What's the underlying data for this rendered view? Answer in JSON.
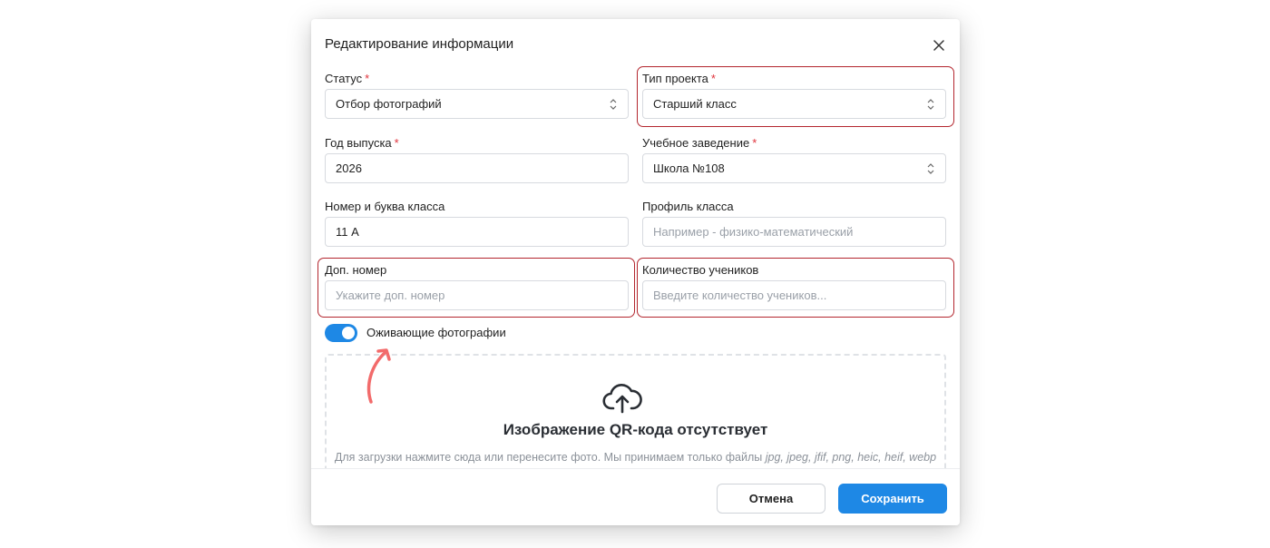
{
  "modal": {
    "title": "Редактирование информации",
    "close_icon": "close-icon"
  },
  "fields": {
    "status": {
      "label": "Статус",
      "required_mark": "*",
      "value": "Отбор фотографий",
      "type": "select"
    },
    "project_type": {
      "label": "Тип проекта",
      "required_mark": "*",
      "value": "Старший класс",
      "type": "select"
    },
    "graduation_year": {
      "label": "Год выпуска",
      "required_mark": "*",
      "value": "2026",
      "type": "text"
    },
    "school": {
      "label": "Учебное заведение",
      "required_mark": "*",
      "value": "Школа №108",
      "type": "select"
    },
    "class_number": {
      "label": "Номер и буква класса",
      "value": "11 А",
      "type": "text"
    },
    "class_profile": {
      "label": "Профиль класса",
      "value": "",
      "placeholder": "Например - физико-математический",
      "type": "text"
    },
    "extra_number": {
      "label": "Доп. номер",
      "value": "",
      "placeholder": "Укажите доп. номер",
      "type": "text"
    },
    "students_count": {
      "label": "Количество учеников",
      "value": "",
      "placeholder": "Введите количество учеников...",
      "type": "text"
    }
  },
  "toggle": {
    "label": "Оживающие фотографии",
    "on": true
  },
  "dropzone": {
    "icon": "cloud-upload-icon",
    "title": "Изображение QR-кода отсутствует",
    "subtitle_text": "Для загрузки нажмите сюда или перенесите фото. Мы принимаем только файлы ",
    "subtitle_formats": "jpg, jpeg, jfif, png, heic, heif, webp"
  },
  "footer": {
    "cancel_label": "Отмена",
    "save_label": "Сохранить"
  },
  "colors": {
    "accent": "#1e88e5",
    "required": "#e0343d",
    "highlight_border": "#b3262e",
    "annotation_arrow": "#f26b6b"
  }
}
